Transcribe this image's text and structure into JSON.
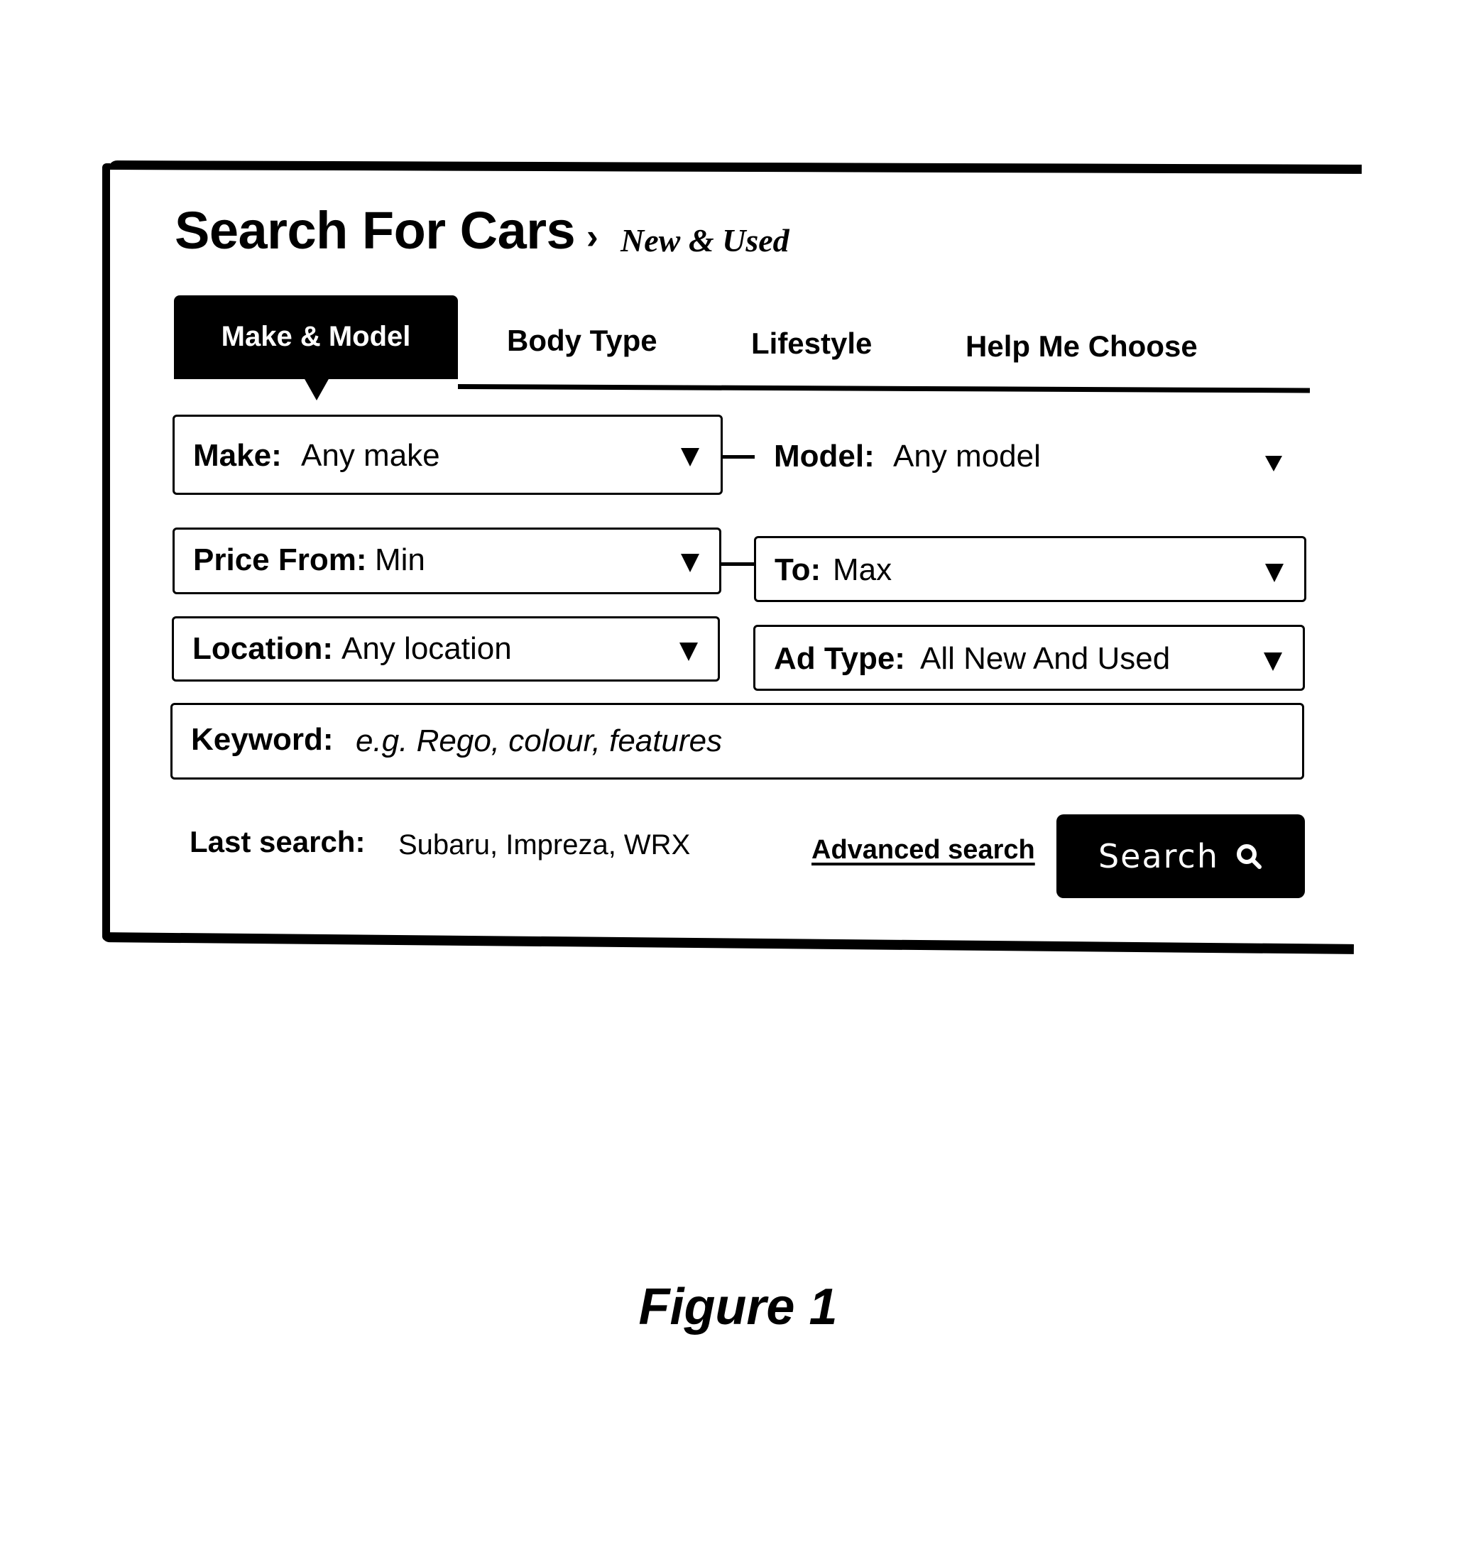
{
  "header": {
    "title": "Search For Cars",
    "breadcrumb_separator": "›",
    "subtitle": "New & Used"
  },
  "tabs": [
    {
      "label": "Make & Model",
      "active": true
    },
    {
      "label": "Body Type",
      "active": false
    },
    {
      "label": "Lifestyle",
      "active": false
    },
    {
      "label": "Help Me Choose",
      "active": false
    }
  ],
  "fields": {
    "make": {
      "label": "Make:",
      "value": "Any make",
      "icon": "dropdown-arrow-icon"
    },
    "model": {
      "label": "Model:",
      "value": "Any model",
      "icon": "dropdown-arrow-icon"
    },
    "price_from": {
      "label": "Price From:",
      "value": "Min",
      "icon": "dropdown-arrow-icon"
    },
    "price_to": {
      "label": "To:",
      "value": "Max",
      "icon": "dropdown-arrow-icon"
    },
    "location": {
      "label": "Location:",
      "value": "Any location",
      "icon": "dropdown-arrow-icon"
    },
    "ad_type": {
      "label": "Ad Type:",
      "value": "All New And Used",
      "icon": "dropdown-arrow-icon"
    },
    "keyword": {
      "label": "Keyword:",
      "placeholder": "e.g. Rego, colour, features",
      "value": ""
    }
  },
  "footer": {
    "last_search_label": "Last search:",
    "last_search_value": "Subaru, Impreza, WRX",
    "advanced_search_label": "Advanced search",
    "search_button_label": "Search",
    "search_icon": "magnifier-icon"
  },
  "caption": "Figure 1"
}
